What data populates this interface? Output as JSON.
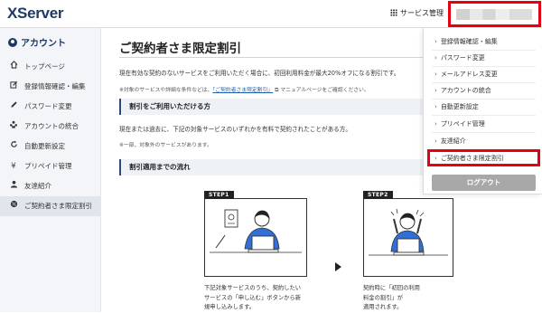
{
  "header": {
    "logo": "XServer",
    "service_menu_label": "サービス管理"
  },
  "sidebar": {
    "heading": "アカウント",
    "items": [
      {
        "label": "トップページ",
        "icon": "home-icon"
      },
      {
        "label": "登録情報確認・編集",
        "icon": "edit-icon"
      },
      {
        "label": "パスワード変更",
        "icon": "pencil-icon"
      },
      {
        "label": "アカウントの統合",
        "icon": "merge-users-icon"
      },
      {
        "label": "自動更新設定",
        "icon": "refresh-icon"
      },
      {
        "label": "プリペイド管理",
        "icon": "yen-icon"
      },
      {
        "label": "友達紹介",
        "icon": "person-icon"
      },
      {
        "label": "ご契約者さま限定割引",
        "icon": "discount-icon"
      }
    ],
    "active_index": 7
  },
  "main": {
    "title": "ご契約者さま限定割引",
    "lead": "現在有効な契約のないサービスをご利用いただく場合に、初回利用料金が最大20%オフになる割引です。",
    "note_prefix": "※対象のサービスや詳細な条件などは、",
    "note_link": "「ご契約者さま限定割引」",
    "note_suffix": "マニュアルページをご確認ください。",
    "section1_title": "割引をご利用いただける方",
    "section1_text": "現在または過去に、下記の対象サービスのいずれかを有料で契約されたことがある方。",
    "section1_note": "※一部、対象外のサービスがあります。",
    "section2_title": "割引適用までの流れ",
    "steps": [
      {
        "label": "STEP1",
        "caption": [
          "下記対象サービスのうち、契約したい",
          "サービスの「申し込む」ボタンから新",
          "規申し込みします。"
        ]
      },
      {
        "label": "STEP2",
        "caption": [
          "契約時に「初回の利用料金の割引」が",
          "適用されます。"
        ]
      }
    ]
  },
  "dropdown": {
    "items": [
      "登録情報確認・編集",
      "パスワード変更",
      "メールアドレス変更",
      "アカウントの統合",
      "自動更新設定",
      "プリペイド管理",
      "友達紹介",
      "ご契約者さま限定割引"
    ],
    "logout_label": "ログアウト"
  },
  "colors": {
    "brand": "#1f3a62",
    "highlight": "#e60012",
    "shirt": "#2f6fd6",
    "section_bg": "#eef2f6"
  }
}
